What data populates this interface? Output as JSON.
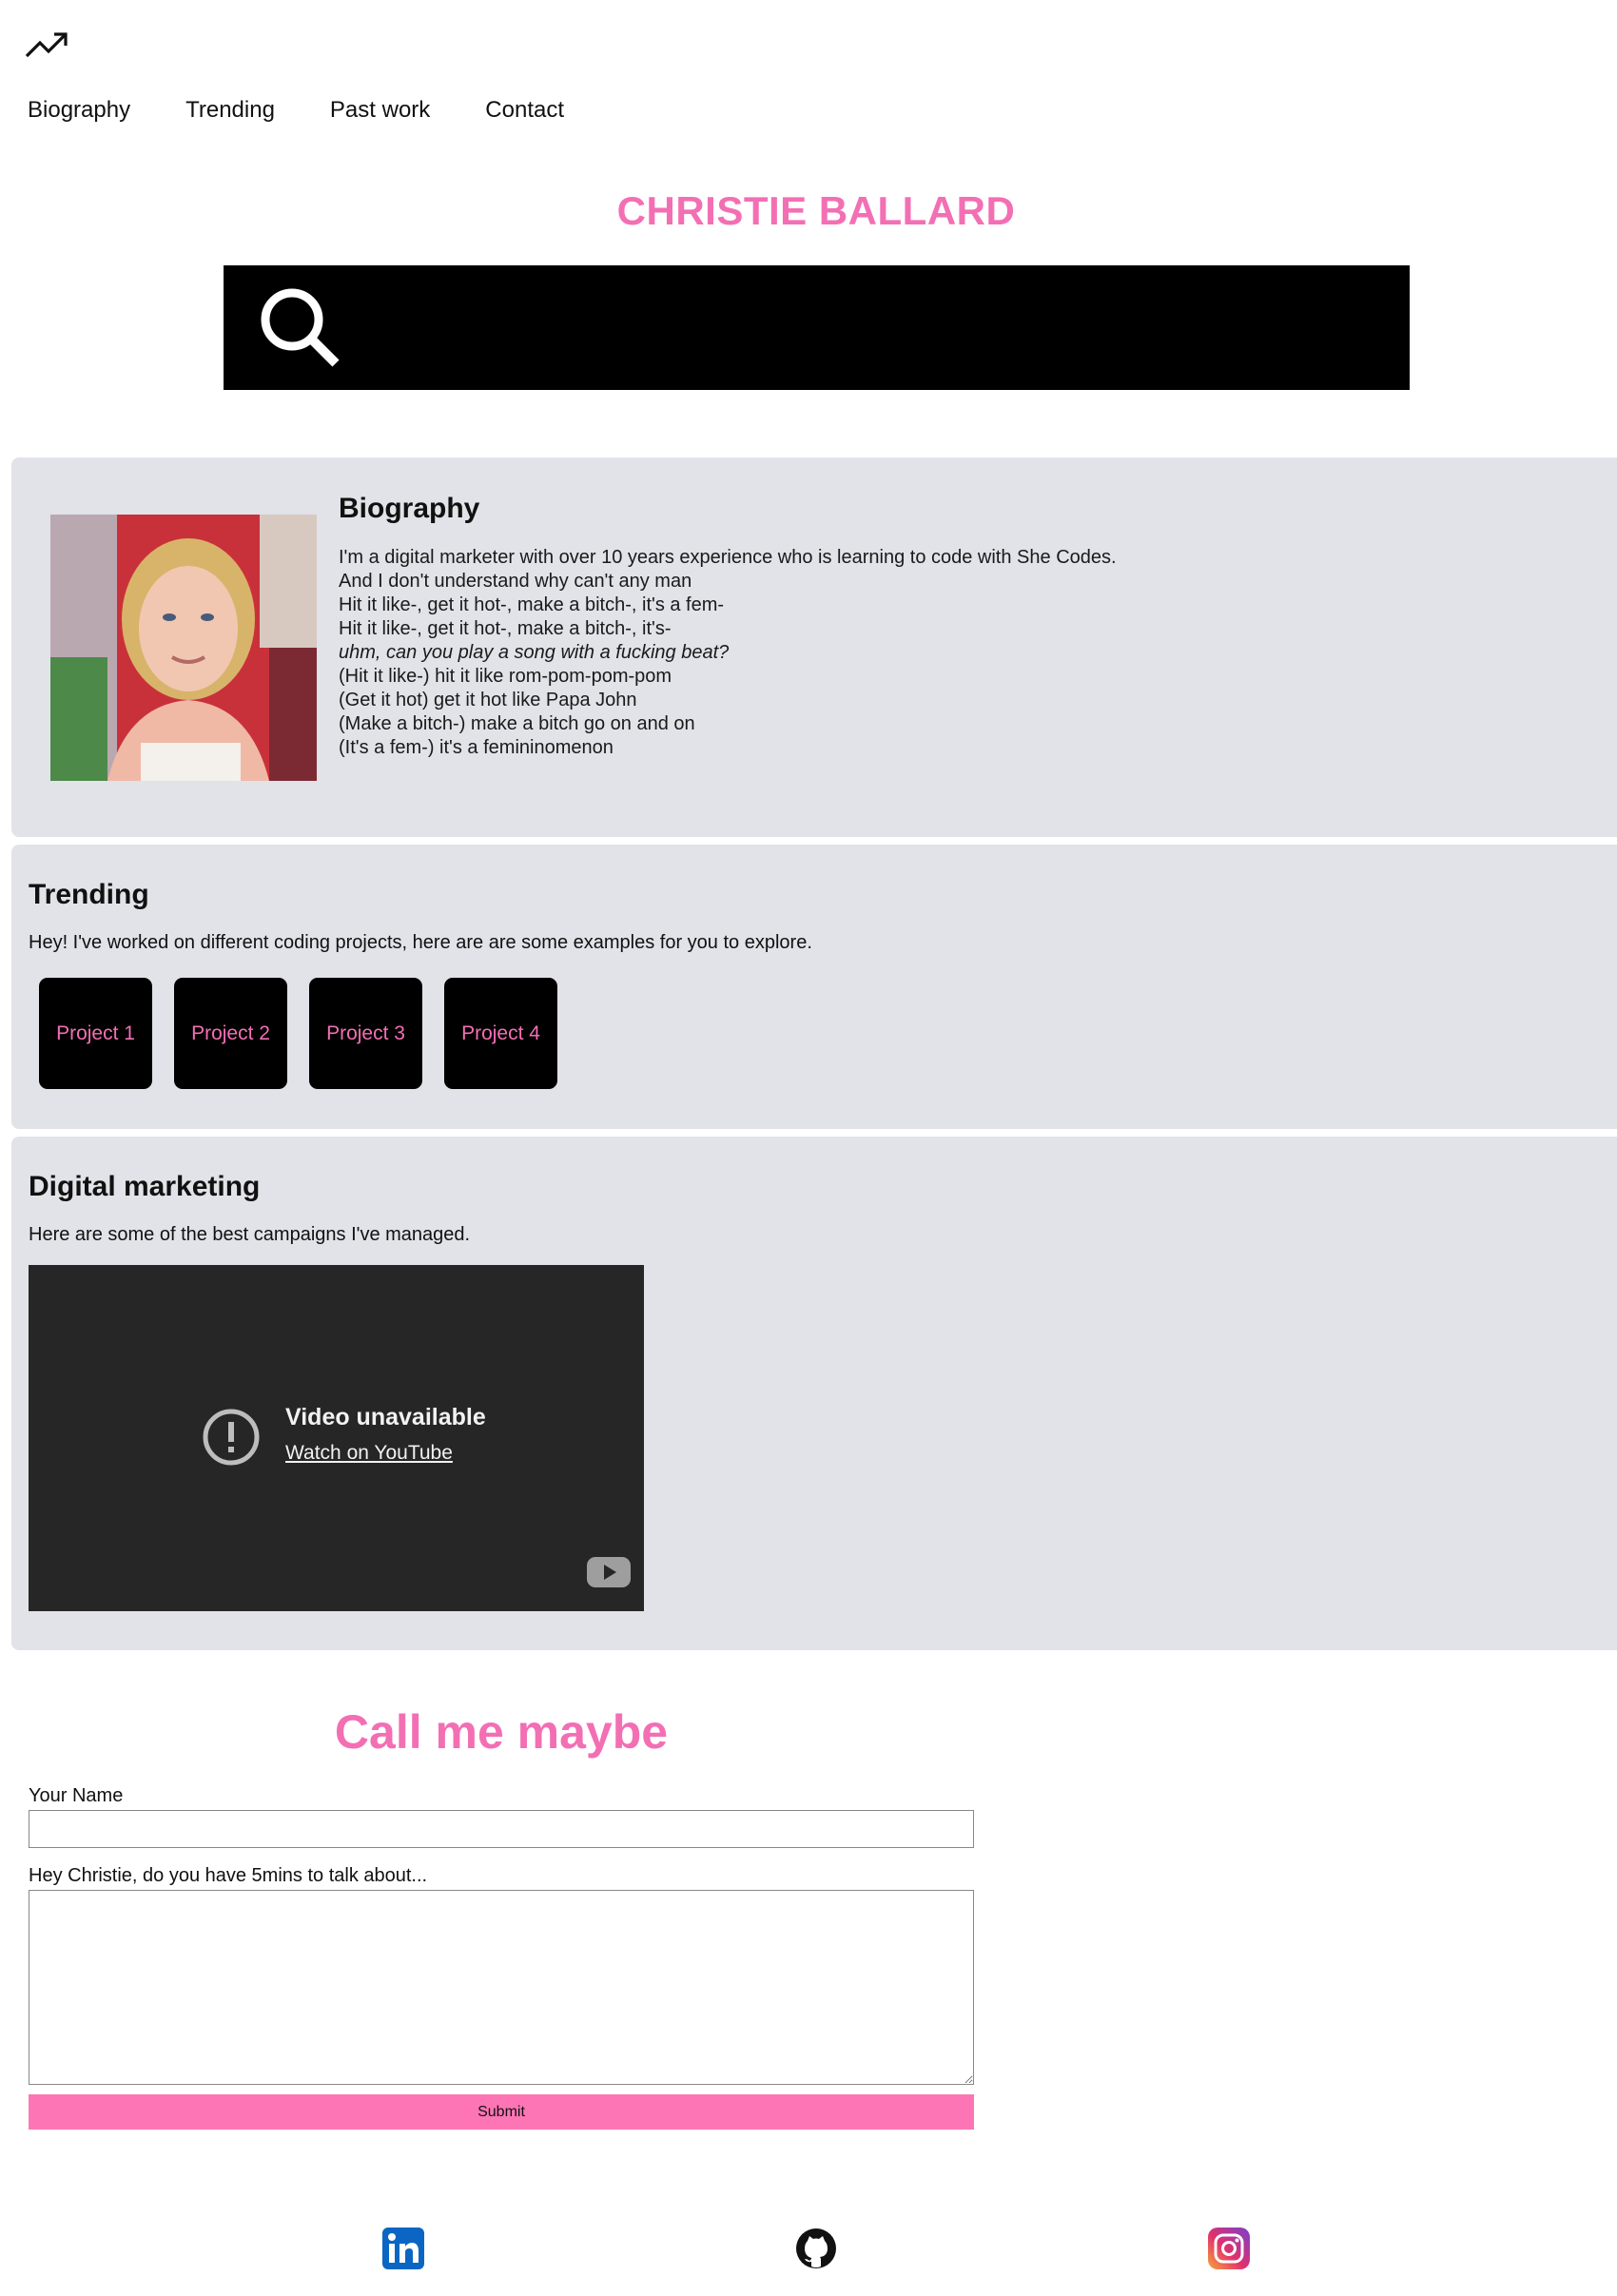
{
  "nav": {
    "logo_icon": "trending-up-icon",
    "items": [
      "Biography",
      "Trending",
      "Past work",
      "Contact"
    ]
  },
  "header": {
    "title": "CHRISTIE BALLARD",
    "search_icon": "search-icon"
  },
  "biography": {
    "heading": "Biography",
    "lines": [
      "I'm a digital marketer with over 10 years experience who is learning to code with She Codes.",
      "And I don't understand why can't any man",
      "Hit it like-, get it hot-, make a bitch-, it's a fem-",
      "Hit it like-, get it hot-, make a bitch-, it's-",
      "uhm, can you play a song with a fucking beat?",
      "(Hit it like-) hit it like rom-pom-pom-pom",
      "(Get it hot) get it hot like Papa John",
      "(Make a bitch-) make a bitch go on and on",
      "(It's a fem-) it's a femininomenon"
    ]
  },
  "trending": {
    "heading": "Trending",
    "intro": "Hey! I've worked on different coding projects, here are are some examples for you to explore.",
    "projects": [
      "Project 1",
      "Project 2",
      "Project 3",
      "Project 4"
    ]
  },
  "digital_marketing": {
    "heading": "Digital marketing",
    "intro": "Here are some of the best campaigns I've managed.",
    "video": {
      "title": "Video unavailable",
      "link": "Watch on YouTube"
    }
  },
  "contact": {
    "heading": "Call me maybe",
    "name_label": "Your Name",
    "message_label": "Hey Christie, do you have 5mins to talk about...",
    "submit_label": "Submit"
  },
  "footer": {
    "icons": [
      "linkedin-icon",
      "github-icon",
      "instagram-icon"
    ]
  },
  "colors": {
    "accent_pink": "#f36fb4",
    "panel_grey": "#e2e2e9",
    "submit_pink": "#fd75b5"
  }
}
